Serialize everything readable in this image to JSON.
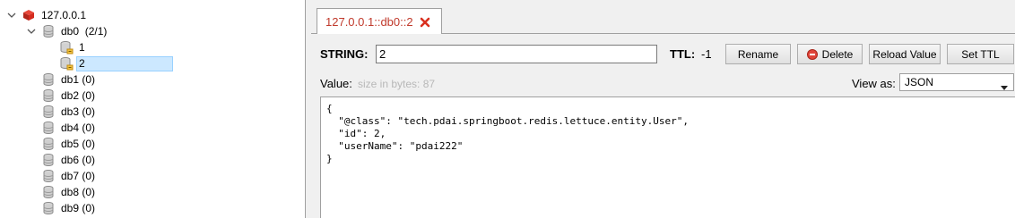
{
  "tree": {
    "server": {
      "label": "127.0.0.1",
      "icon": "redis-server-icon",
      "expanded": true
    },
    "db0": {
      "name": "db0",
      "count": "(2/1)",
      "expanded": true,
      "keys": [
        {
          "label": "1",
          "selected": false
        },
        {
          "label": "2",
          "selected": true
        }
      ]
    },
    "databases": [
      {
        "name": "db1",
        "count": "(0)"
      },
      {
        "name": "db2",
        "count": "(0)"
      },
      {
        "name": "db3",
        "count": "(0)"
      },
      {
        "name": "db4",
        "count": "(0)"
      },
      {
        "name": "db5",
        "count": "(0)"
      },
      {
        "name": "db6",
        "count": "(0)"
      },
      {
        "name": "db7",
        "count": "(0)"
      },
      {
        "name": "db8",
        "count": "(0)"
      },
      {
        "name": "db9",
        "count": "(0)"
      }
    ]
  },
  "tab": {
    "label": "127.0.0.1::db0::2"
  },
  "key_panel": {
    "type_label": "STRING:",
    "key_value": "2",
    "ttl_label": "TTL:",
    "ttl_value": "-1",
    "buttons": {
      "rename": "Rename",
      "delete": "Delete",
      "reload": "Reload Value",
      "set_ttl": "Set TTL"
    },
    "value_label": "Value:",
    "size_hint": "size in bytes: 87",
    "view_as_label": "View as:",
    "view_as_selected": "JSON",
    "value_lines": [
      "{",
      "  \"@class\": \"tech.pdai.springboot.redis.lettuce.entity.User\",",
      "  \"id\": 2,",
      "  \"userName\": \"pdai222\"",
      "}"
    ]
  },
  "colors": {
    "tab_text": "#c0392b",
    "selection": "#cce8ff",
    "redis_red": "#d42b1e"
  }
}
